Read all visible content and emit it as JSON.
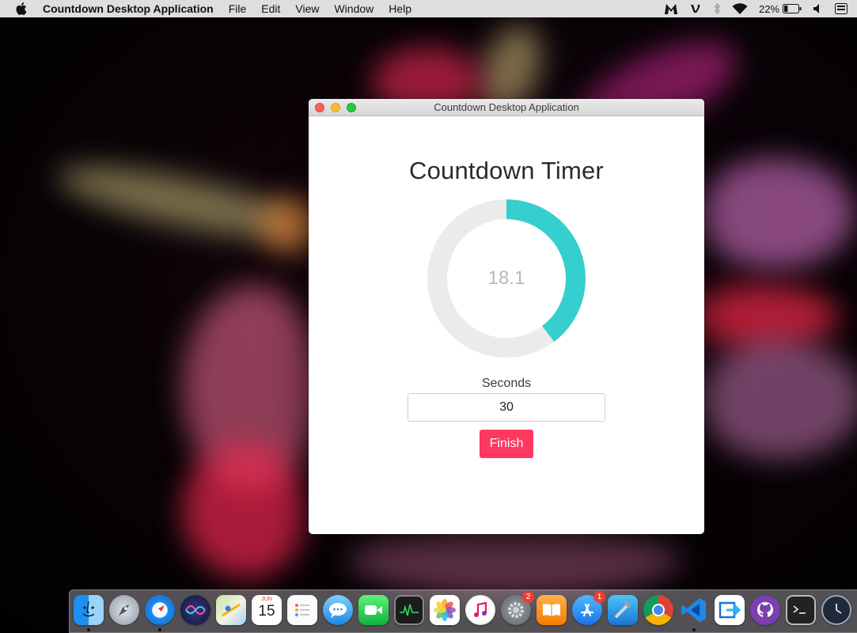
{
  "menubar": {
    "apple_icon": "apple-logo-icon",
    "items": [
      "Countdown Desktop Application",
      "File",
      "Edit",
      "View",
      "Window",
      "Help"
    ],
    "battery_percent": "22%",
    "status_icons": [
      "malwarebytes-icon",
      "vine-icon",
      "bluetooth-icon",
      "wifi-icon",
      "battery-icon",
      "volume-icon",
      "keyboard-input-icon"
    ]
  },
  "window": {
    "title": "Countdown Desktop Application",
    "heading": "Countdown Timer",
    "timer": {
      "display_value": "18.1",
      "total_seconds": 30,
      "progress_fraction": 0.397,
      "progress_color": "#35cfcf",
      "track_color": "#ebebeb"
    },
    "seconds_label": "Seconds",
    "seconds_value": "30",
    "finish_label": "Finish",
    "finish_color": "#ff3860"
  },
  "dock": {
    "apps": [
      {
        "name": "finder-icon",
        "running": true
      },
      {
        "name": "launchpad-icon",
        "running": false
      },
      {
        "name": "safari-icon",
        "running": true
      },
      {
        "name": "siri-icon",
        "running": false
      },
      {
        "name": "maps-icon",
        "running": false
      },
      {
        "name": "calendar-icon",
        "running": false,
        "month": "JUN",
        "day": "15"
      },
      {
        "name": "reminders-icon",
        "running": false
      },
      {
        "name": "messages-icon",
        "running": false
      },
      {
        "name": "facetime-icon",
        "running": false
      },
      {
        "name": "activity-monitor-icon",
        "running": false
      },
      {
        "name": "photos-icon",
        "running": false
      },
      {
        "name": "itunes-icon",
        "running": false
      },
      {
        "name": "system-preferences-icon",
        "running": false,
        "badge": "2"
      },
      {
        "name": "books-icon",
        "running": false
      },
      {
        "name": "app-store-icon",
        "running": false,
        "badge": "1"
      },
      {
        "name": "xcode-icon",
        "running": false
      },
      {
        "name": "chrome-icon",
        "running": false
      },
      {
        "name": "vscode-icon",
        "running": true
      },
      {
        "name": "forward-app-icon",
        "running": false
      },
      {
        "name": "github-desktop-icon",
        "running": false
      },
      {
        "name": "terminal-icon",
        "running": false
      },
      {
        "name": "clock-icon",
        "running": false
      }
    ]
  }
}
